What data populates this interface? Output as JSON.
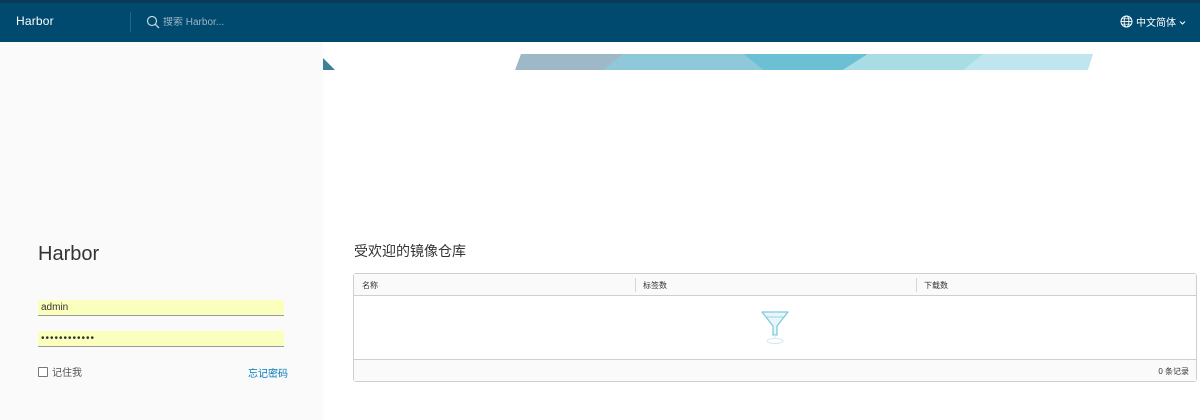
{
  "header": {
    "brand": "Harbor",
    "search_placeholder": "搜索 Harbor...",
    "language": "中文简体"
  },
  "login": {
    "title": "Harbor",
    "username": "admin",
    "password": "••••••••••••",
    "remember_label": "记住我",
    "forgot_label": "忘记密码"
  },
  "repositories": {
    "title": "受欢迎的镜像仓库",
    "columns": [
      "名称",
      "标签数",
      "下载数"
    ],
    "rows": [],
    "footer_count": "0 条记录"
  },
  "colors": {
    "header_bg": "#004a70",
    "link": "#0079b8",
    "autofill": "#faffbd"
  }
}
